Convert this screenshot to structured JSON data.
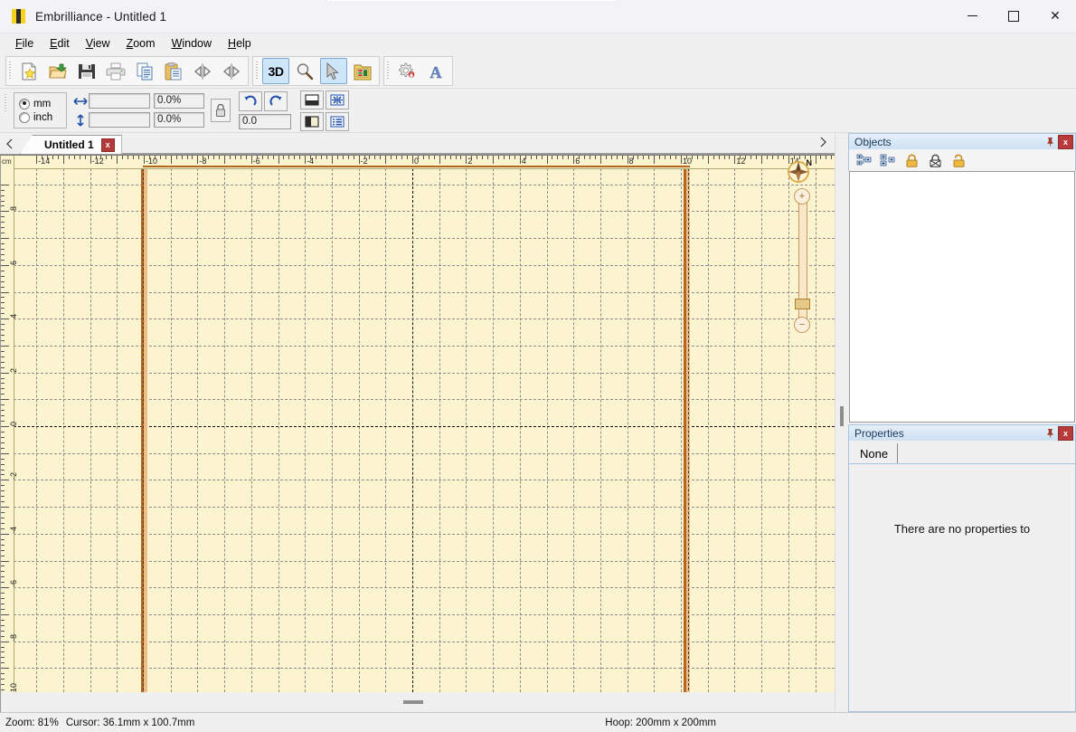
{
  "window": {
    "title": "Embrilliance -  Untitled 1",
    "app_icon": "embrilliance-logo-icon",
    "minimize_label": "—",
    "maximize_label": "□",
    "close_label": "✕"
  },
  "menubar": {
    "items": [
      {
        "name": "file",
        "label": "File",
        "accel": "F"
      },
      {
        "name": "edit",
        "label": "Edit",
        "accel": "E"
      },
      {
        "name": "view",
        "label": "View",
        "accel": "V"
      },
      {
        "name": "zoom",
        "label": "Zoom",
        "accel": "Z"
      },
      {
        "name": "window",
        "label": "Window",
        "accel": "W"
      },
      {
        "name": "help",
        "label": "Help",
        "accel": "H"
      }
    ]
  },
  "toolbar_main": {
    "group1": [
      {
        "name": "new-design-button",
        "icon": "new-document-icon",
        "tooltip": "New"
      },
      {
        "name": "open-button",
        "icon": "open-folder-icon",
        "tooltip": "Open"
      },
      {
        "name": "save-button",
        "icon": "floppy-disk-icon",
        "tooltip": "Save"
      },
      {
        "name": "print-button",
        "icon": "printer-icon",
        "tooltip": "Print"
      },
      {
        "name": "copy-button",
        "icon": "copy-icon",
        "tooltip": "Copy"
      },
      {
        "name": "paste-button",
        "icon": "paste-icon",
        "tooltip": "Paste"
      },
      {
        "name": "flip-horizontal-button",
        "icon": "flip-horizontal-icon",
        "tooltip": "Flip Horizontal"
      },
      {
        "name": "flip-vertical-button",
        "icon": "flip-vertical-icon",
        "tooltip": "Flip Vertical"
      }
    ],
    "group2": [
      {
        "name": "three-d-toggle",
        "icon": "3d-icon",
        "label": "3D",
        "active": true
      },
      {
        "name": "magnifier-button",
        "icon": "magnifier-icon",
        "active": false
      },
      {
        "name": "select-pointer-button",
        "icon": "cursor-arrow-icon",
        "active": true
      },
      {
        "name": "color-list-button",
        "icon": "color-list-icon",
        "active": false
      }
    ],
    "group3": [
      {
        "name": "settings-button",
        "icon": "gear-heart-icon"
      },
      {
        "name": "text-tool-button",
        "icon": "letter-a-icon"
      }
    ]
  },
  "toolbar_props": {
    "units": {
      "name": "units-radio-group",
      "options": [
        "mm",
        "inch"
      ],
      "selected": "mm"
    },
    "width": {
      "name": "width-field",
      "value": "",
      "icon": "width-arrows-icon"
    },
    "height": {
      "name": "height-field",
      "value": "",
      "icon": "height-arrows-icon"
    },
    "width_percent": {
      "name": "width-percent-field",
      "value": "0.0%"
    },
    "height_percent": {
      "name": "height-percent-field",
      "value": "0.0%"
    },
    "lock_aspect": {
      "name": "lock-aspect-button",
      "icon": "padlock-icon"
    },
    "rotate_ccw": {
      "name": "rotate-ccw-button",
      "icon": "rotate-counterclockwise-icon"
    },
    "rotate_cw": {
      "name": "rotate-cw-button",
      "icon": "rotate-clockwise-icon"
    },
    "rotation": {
      "name": "rotation-field",
      "value": "0.0"
    },
    "view_buttons": [
      {
        "name": "view-split-horizontal-button",
        "icon": "split-horizontal-icon"
      },
      {
        "name": "view-fit-button",
        "icon": "fit-to-window-icon"
      },
      {
        "name": "view-split-vertical-button",
        "icon": "split-vertical-icon"
      },
      {
        "name": "view-list-button",
        "icon": "list-view-icon"
      }
    ]
  },
  "tabstrip": {
    "scroll_left": {
      "name": "tab-scroll-left",
      "icon": "triangle-left-icon"
    },
    "scroll_right": {
      "name": "tab-scroll-right",
      "icon": "triangle-right-icon"
    },
    "tabs": [
      {
        "name": "tab-untitled-1",
        "label": "Untitled 1",
        "close_label": "x",
        "active": true
      }
    ]
  },
  "canvas": {
    "unit_label": "cm",
    "ruler_h_labels": [
      "-14",
      "-12",
      "-10",
      "-8",
      "-6",
      "-4",
      "-2",
      "0",
      "2",
      "4",
      "6",
      "8",
      "10",
      "12"
    ],
    "ruler_v_labels": [
      "8",
      "6",
      "4",
      "2",
      "0",
      "-2",
      "-4",
      "-6",
      "-8",
      "-10"
    ],
    "compass": {
      "name": "compass-rose-icon",
      "label": "N"
    },
    "zoom_slider": {
      "name": "zoom-slider",
      "zoom_in_label": "+",
      "zoom_out_label": "−"
    },
    "hoop_color": "#b5651d",
    "background_color": "#fbf4cf",
    "grid_color": "#8d8d8d"
  },
  "objects_panel": {
    "title": "Objects",
    "pin_label": "⚐",
    "close_label": "x",
    "toolbar": [
      {
        "name": "expand-tree-button",
        "icon": "expand-tree-icon"
      },
      {
        "name": "collapse-tree-button",
        "icon": "collapse-tree-icon"
      },
      {
        "name": "lock-closed-button",
        "icon": "lock-closed-icon"
      },
      {
        "name": "lock-disabled-button",
        "icon": "lock-crossed-icon"
      },
      {
        "name": "lock-open-button",
        "icon": "lock-open-icon"
      }
    ]
  },
  "properties_panel": {
    "title": "Properties",
    "pin_label": "⚐",
    "close_label": "x",
    "tabs": [
      {
        "name": "props-tab-none",
        "label": "None"
      }
    ],
    "empty_message": "There are no properties to"
  },
  "statusbar": {
    "zoom": "Zoom: 81%",
    "cursor": "Cursor: 36.1mm x 100.7mm",
    "hoop": "Hoop: 200mm x 200mm"
  }
}
